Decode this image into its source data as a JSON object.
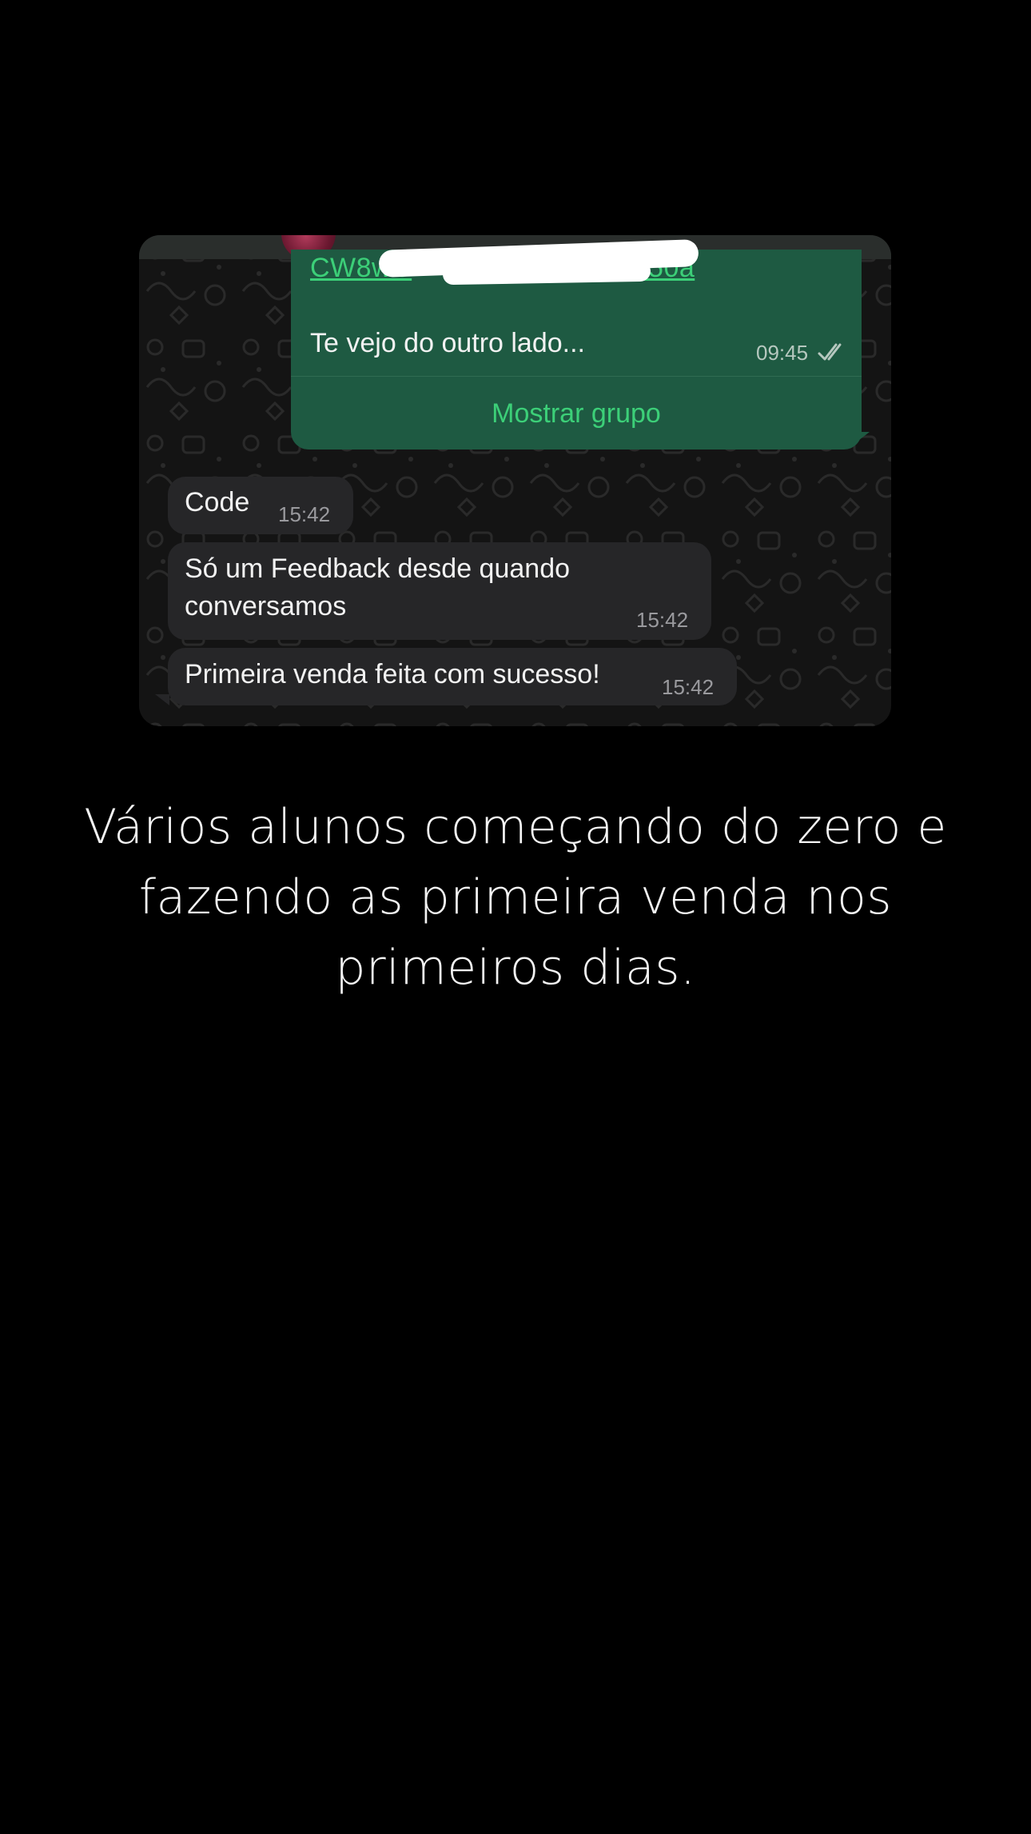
{
  "chat": {
    "sent_message": {
      "link_left": "CW8wC",
      "link_right": "N50a",
      "text": "Te vejo do outro lado...",
      "time": "09:45",
      "action_label": "Mostrar grupo"
    },
    "received_messages": [
      {
        "text": "Code",
        "time": "15:42"
      },
      {
        "text": "Só um Feedback desde quando conversamos",
        "time": "15:42"
      },
      {
        "text": "Primeira venda feita com sucesso!",
        "time": "15:42"
      }
    ]
  },
  "caption": {
    "text": "Vários alunos começando do zero e fazendo as primeira venda nos primeiros dias."
  },
  "colors": {
    "background": "#000000",
    "sent_bubble": "#1e5a42",
    "received_bubble": "#262628",
    "accent_green": "#3ccf78"
  },
  "icons": {
    "read_receipt": "double-check-icon"
  }
}
